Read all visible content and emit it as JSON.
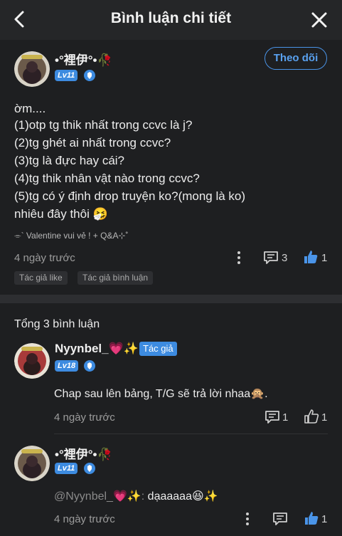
{
  "header": {
    "title": "Bình luận chi tiết",
    "back_icon": "back-arrow-icon",
    "close_icon": "close-icon"
  },
  "post": {
    "author": {
      "name": "•°裡伊°•🥀",
      "level": "Lv11"
    },
    "follow_label": "Theo dõi",
    "lines": [
      "ờm....",
      "(1)otp tg thik nhất trong ccvc là j?",
      "(2)tg ghét ai nhất trong ccvc?",
      "(3)tg là đực hay cái?",
      "(4)tg thik nhân vật nào trong ccvc?",
      "(5)tg có ý định drop truyện ko?(mong là ko)",
      "nhiêu đây thôi 🤧"
    ],
    "signature": "⌯` Valentine vui vẻ ! + Q&A⊹˚",
    "time": "4 ngày trước",
    "comment_count": "3",
    "like_count": "1",
    "tags": [
      "Tác giả like",
      "Tác giả bình luận"
    ]
  },
  "comments_total": "Tổng 3 bình luận",
  "comments": [
    {
      "name": "Nyynbel_💗✨",
      "badge": "Tác giả",
      "level": "Lv18",
      "text": "Chap sau lên bảng, T/G sẽ trả lời nhaa🙊.",
      "time": "4 ngày trước",
      "reply_count": "1",
      "like_count": "1"
    },
    {
      "name": "•°裡伊°•🥀",
      "level": "Lv11",
      "mention": "@Nyynbel_💗✨:",
      "text": " dạaaaaa😆✨",
      "time": "4 ngày trước",
      "like_count": "1"
    }
  ],
  "colors": {
    "accent": "#3d8be0",
    "background": "#1e1f21"
  }
}
